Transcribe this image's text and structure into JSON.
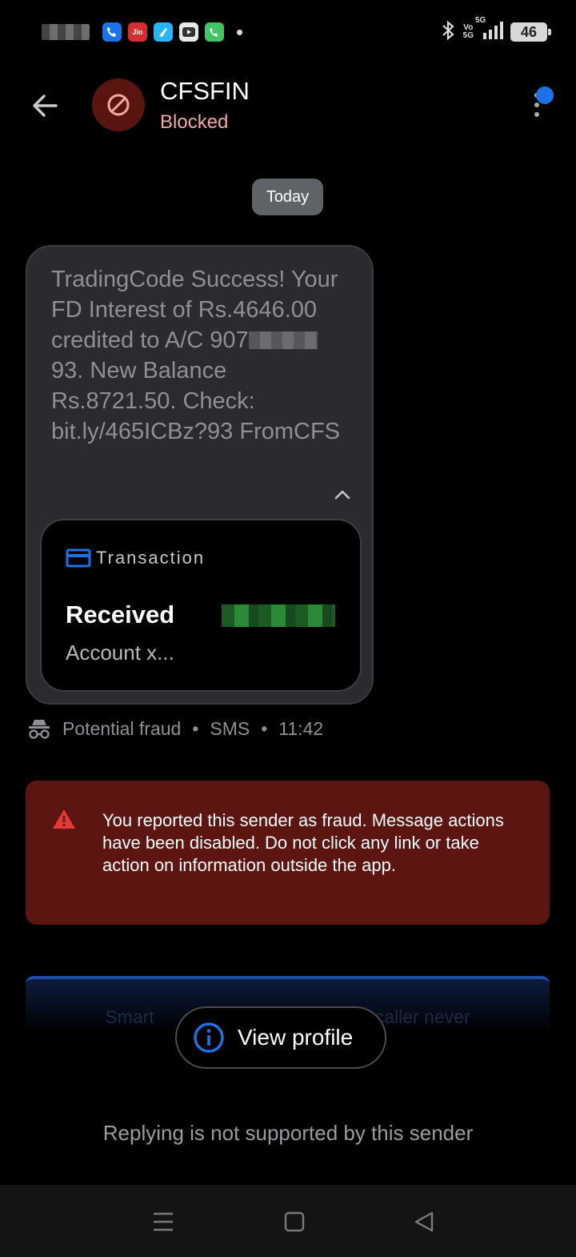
{
  "status_bar": {
    "apps": [
      {
        "icon": "phone-app-icon",
        "color": "#1a73e8"
      },
      {
        "icon": "jio-app-icon",
        "label": "Jio",
        "color": "#d32f2f"
      },
      {
        "icon": "cleaner-app-icon",
        "color": "#29b6f6"
      },
      {
        "icon": "youtube-app-icon",
        "color": "#ffffff"
      },
      {
        "icon": "whatsapp-call-icon",
        "color": "#43c463"
      }
    ],
    "volte": "Vo\n5G",
    "network": "5G",
    "battery": "46"
  },
  "header": {
    "title": "CFSFIN",
    "status": "Blocked",
    "avatar_icon": "blocked-icon"
  },
  "date_chip": "Today",
  "message": {
    "line1": "TradingCode Success! Your FD Interest of Rs.4646.00 credited to A/C 907",
    "line2": "93. New Balance Rs.8721.50. Check: bit.ly/465ICBz?93 FromCFS",
    "card": {
      "label": "Transaction",
      "title": "Received",
      "account": "Account x..."
    }
  },
  "meta": {
    "tag": "Potential fraud",
    "channel": "SMS",
    "time": "11:42",
    "sep": "•"
  },
  "fraud_banner": {
    "text": "You reported this sender as fraud. Message actions have been disabled. Do not click any link or take action on information outside the app."
  },
  "promo": {
    "text": "Smart                                    Truecaller never"
  },
  "view_profile": "View profile",
  "reply_note": "Replying is not supported by this sender",
  "colors": {
    "accent": "#1a73e8",
    "blocked": "#f4a6a0",
    "fraud_bg": "#5c1510",
    "warning": "#e53935"
  }
}
